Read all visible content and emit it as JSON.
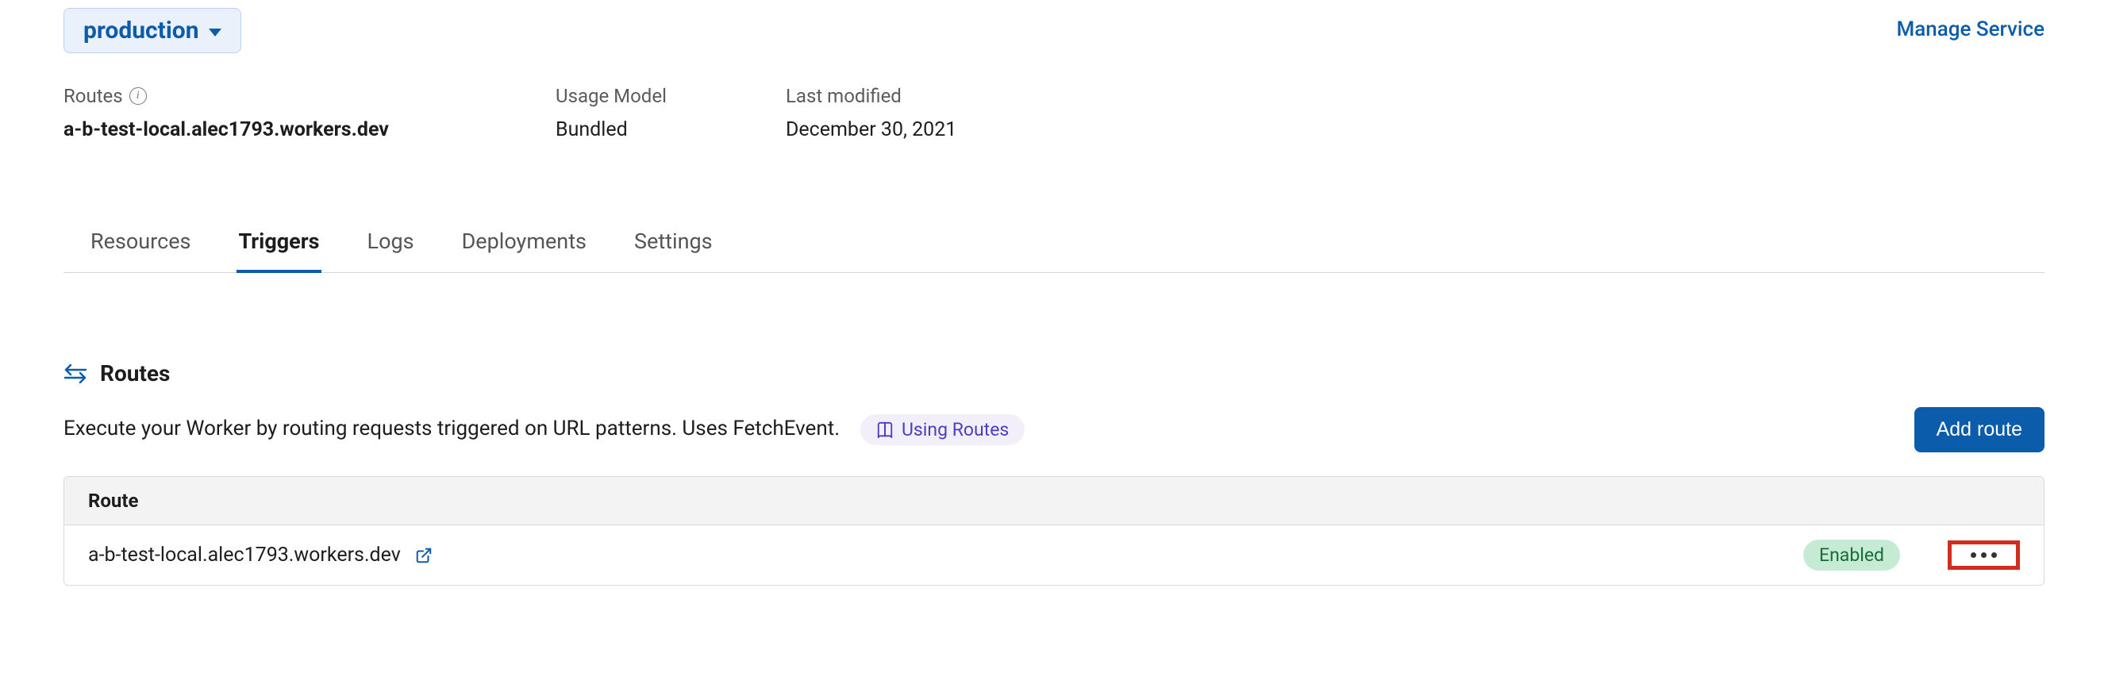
{
  "header": {
    "environment": "production",
    "manage_service": "Manage Service"
  },
  "meta": {
    "routes_label": "Routes",
    "routes_value": "a-b-test-local.alec1793.workers.dev",
    "usage_label": "Usage Model",
    "usage_value": "Bundled",
    "last_modified_label": "Last modified",
    "last_modified_value": "December 30, 2021"
  },
  "tabs": {
    "resources": "Resources",
    "triggers": "Triggers",
    "logs": "Logs",
    "deployments": "Deployments",
    "settings": "Settings"
  },
  "routes_section": {
    "title": "Routes",
    "description": "Execute your Worker by routing requests triggered on URL patterns. Uses FetchEvent.",
    "doc_link": "Using Routes",
    "add_button": "Add route",
    "column_header": "Route",
    "row": {
      "url": "a-b-test-local.alec1793.workers.dev",
      "status": "Enabled"
    }
  }
}
